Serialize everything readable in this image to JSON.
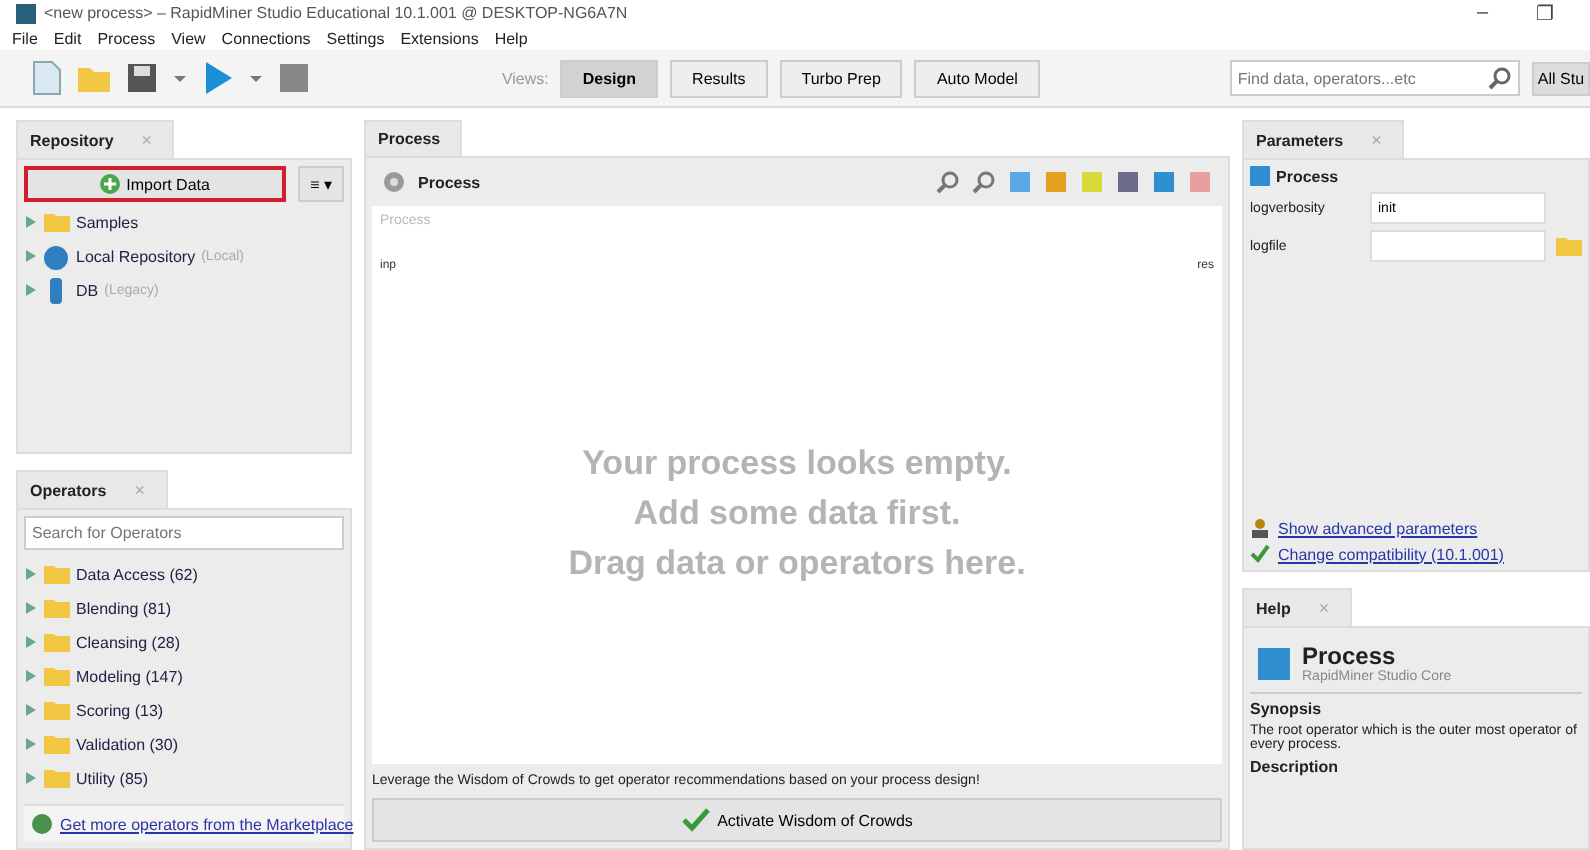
{
  "window": {
    "title": "<new process> – RapidMiner Studio Educational 10.1.001 @ DESKTOP-NG6A7N",
    "controls": [
      "–",
      "❐"
    ]
  },
  "menu": [
    "File",
    "Edit",
    "Process",
    "View",
    "Connections",
    "Settings",
    "Extensions",
    "Help"
  ],
  "views": {
    "label": "Views:",
    "tabs": [
      {
        "label": "Design",
        "selected": true
      },
      {
        "label": "Results",
        "selected": false
      },
      {
        "label": "Turbo Prep",
        "selected": false
      },
      {
        "label": "Auto Model",
        "selected": false
      }
    ]
  },
  "search": {
    "placeholder": "Find data, operators...etc",
    "scope": "All Stu"
  },
  "repository": {
    "title": "Repository",
    "close": "×",
    "import_button": "Import Data",
    "menu_button": "≡ ▾",
    "items": [
      {
        "label": "Samples",
        "kind": "folder"
      },
      {
        "label": "Local Repository",
        "note": "(Local)",
        "kind": "repo"
      },
      {
        "label": "DB",
        "note": "(Legacy)",
        "kind": "db"
      }
    ]
  },
  "operators": {
    "title": "Operators",
    "close": "×",
    "placeholder": "Search for Operators",
    "items": [
      "Data Access (62)",
      "Blending (81)",
      "Cleansing (28)",
      "Modeling (147)",
      "Scoring (13)",
      "Validation (30)",
      "Utility (85)"
    ],
    "marketplace_link": "Get more operators from the Marketplace"
  },
  "process": {
    "tab": "Process",
    "breadcrumb": "Process",
    "canvas_label": "Process",
    "input_port": "inp",
    "result_port": "res",
    "empty_lines": [
      "Your process looks empty.",
      "Add some data first.",
      "Drag data or operators here."
    ],
    "hint": "Leverage the Wisdom of Crowds to get operator recommendations based on your process design!",
    "activate_button": "Activate Wisdom of Crowds"
  },
  "parameters": {
    "title": "Parameters",
    "close": "×",
    "operator": "Process",
    "fields": [
      {
        "label": "logverbosity",
        "value": "init"
      },
      {
        "label": "logfile"
      }
    ],
    "links": [
      {
        "label": "Show advanced parameters",
        "kind": "advanced"
      },
      {
        "label": "Change compatibility (10.1.001)",
        "kind": "compat"
      }
    ]
  },
  "help": {
    "title": "Help",
    "close": "×",
    "operator": "Process",
    "source": "RapidMiner Studio Core",
    "synopsis_heading": "Synopsis",
    "synopsis": "The root operator which is the outer most operator of every process.",
    "description_heading": "Description"
  }
}
